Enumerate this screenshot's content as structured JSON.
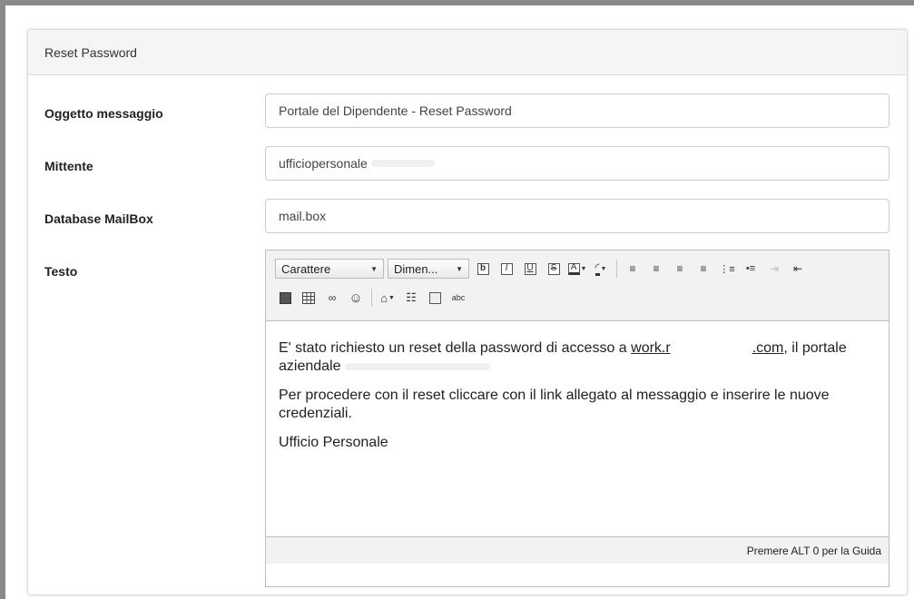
{
  "panel": {
    "title": "Reset Password"
  },
  "fields": {
    "subject": {
      "label": "Oggetto messaggio",
      "value": "Portale del Dipendente - Reset Password"
    },
    "sender": {
      "label": "Mittente",
      "value": "ufficiopersonale"
    },
    "mailbox": {
      "label": "Database MailBox",
      "value": "mail.box"
    },
    "body": {
      "label": "Testo"
    }
  },
  "editor": {
    "font_combo": "Carattere",
    "size_combo": "Dimen...",
    "status": "Premere ALT 0 per la Guida",
    "paragraph1_a": "E' stato richiesto un reset della password di accesso a ",
    "link_start": "work.r",
    "link_end": ".com",
    "paragraph1_b": ", il portale aziendale",
    "paragraph2": "Per procedere con il reset cliccare con il link allegato al messaggio e inserire le nuove credenziali.",
    "paragraph3": "Ufficio Personale"
  },
  "icons": {
    "row1": [
      "bold-icon",
      "italic-icon",
      "underline-icon",
      "strikethrough-icon",
      "text-color-icon",
      "background-color-icon",
      "align-left-icon",
      "align-center-icon",
      "align-right-icon",
      "justify-icon",
      "numbered-list-icon",
      "bulleted-list-icon",
      "indent-icon",
      "outdent-icon"
    ],
    "row2": [
      "image-icon",
      "table-icon",
      "link-icon",
      "smiley-icon",
      "special-char-icon",
      "find-icon",
      "source-icon",
      "spellcheck-icon"
    ]
  }
}
